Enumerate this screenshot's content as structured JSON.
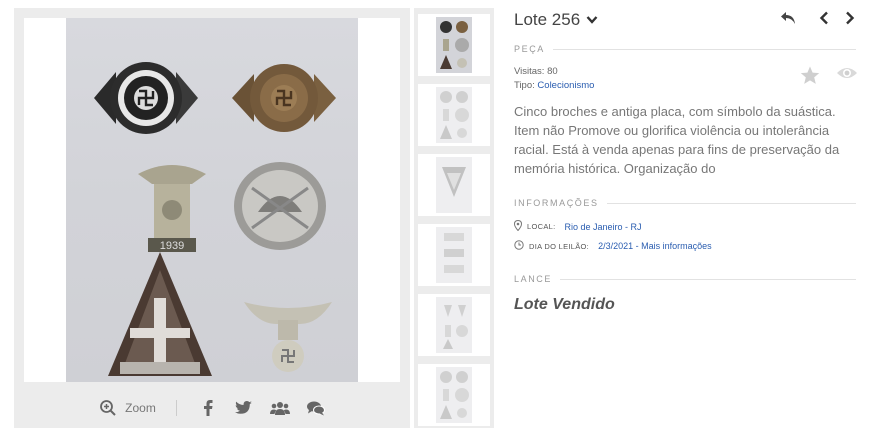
{
  "lot": {
    "title": "Lote 256"
  },
  "piece": {
    "section_label": "PEÇA",
    "visits_label": "Visitas:",
    "visits_value": "80",
    "type_label": "Tipo:",
    "type_value": "Colecionismo",
    "description": "Cinco broches e antiga placa, com símbolo da suástica. Item não Promove ou glorifica violência ou intolerância racial. Está à venda apenas para fins de preservação da memória histórica. Organização do"
  },
  "info": {
    "section_label": "INFORMAÇÕES",
    "local_label": "LOCAL:",
    "local_value": "Rio de Janeiro - RJ",
    "date_label": "DIA DO LEILÃO:",
    "date_value": "2/3/2021 - Mais informações"
  },
  "bid": {
    "section_label": "LANCE",
    "status": "Lote Vendido"
  },
  "toolbar": {
    "zoom_label": "Zoom"
  },
  "icons": {
    "zoom": "zoom-in-icon",
    "facebook": "facebook-icon",
    "twitter": "twitter-icon",
    "group": "group-icon",
    "chat": "chat-icon",
    "back": "reply-arrow-icon",
    "prev": "chevron-left-icon",
    "next": "chevron-right-icon",
    "star": "star-icon",
    "eye": "eye-icon",
    "dropdown": "chevron-down-icon"
  },
  "colors": {
    "link": "#2a5db0",
    "panel": "#ececec"
  }
}
